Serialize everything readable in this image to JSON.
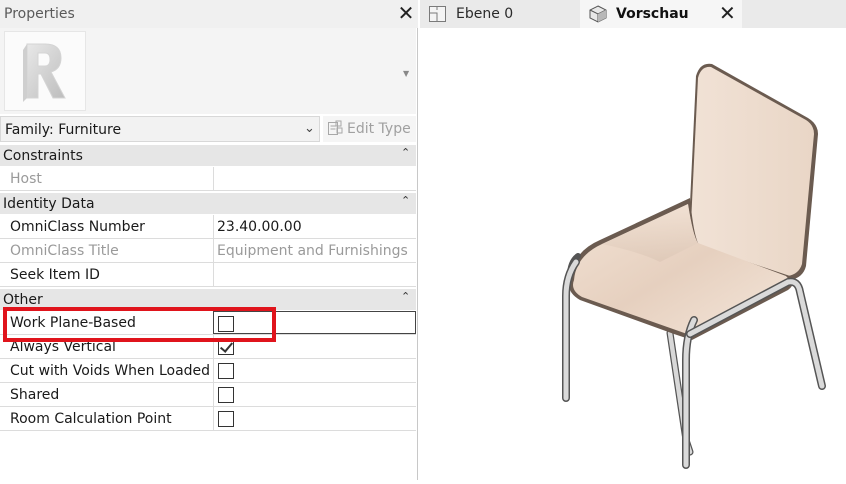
{
  "properties": {
    "title": "Properties",
    "family_select": "Family: Furniture",
    "edit_type": "Edit Type",
    "groups": {
      "constraints": "Constraints",
      "identity": "Identity Data",
      "other": "Other"
    },
    "rows": {
      "host": {
        "name": "Host",
        "value": ""
      },
      "omniclass_number": {
        "name": "OmniClass Number",
        "value": "23.40.00.00"
      },
      "omniclass_title": {
        "name": "OmniClass Title",
        "value": "Equipment and Furnishings"
      },
      "seek_item_id": {
        "name": "Seek Item ID",
        "value": ""
      },
      "work_plane_based": {
        "name": "Work Plane-Based",
        "checked": false
      },
      "always_vertical": {
        "name": "Always Vertical",
        "checked": true
      },
      "cut_with_voids": {
        "name": "Cut with Voids When Loaded",
        "checked": false
      },
      "shared": {
        "name": "Shared",
        "checked": false
      },
      "room_calc_point": {
        "name": "Room Calculation Point",
        "checked": false
      }
    }
  },
  "tabs": {
    "ebene": "Ebene 0",
    "vorschau": "Vorschau"
  },
  "icons": {
    "close": "close-icon",
    "collapse": "collapse-icon",
    "chevron": "chevron-down-icon",
    "edit_type": "edit-type-icon",
    "floor_plan": "floor-plan-icon",
    "3d_view": "3d-view-icon",
    "revit_logo": "revit-logo-icon"
  },
  "colors": {
    "highlight": "#e0141c",
    "chair_seat": "#f0dccb",
    "chair_frame": "#c8c8c8"
  }
}
